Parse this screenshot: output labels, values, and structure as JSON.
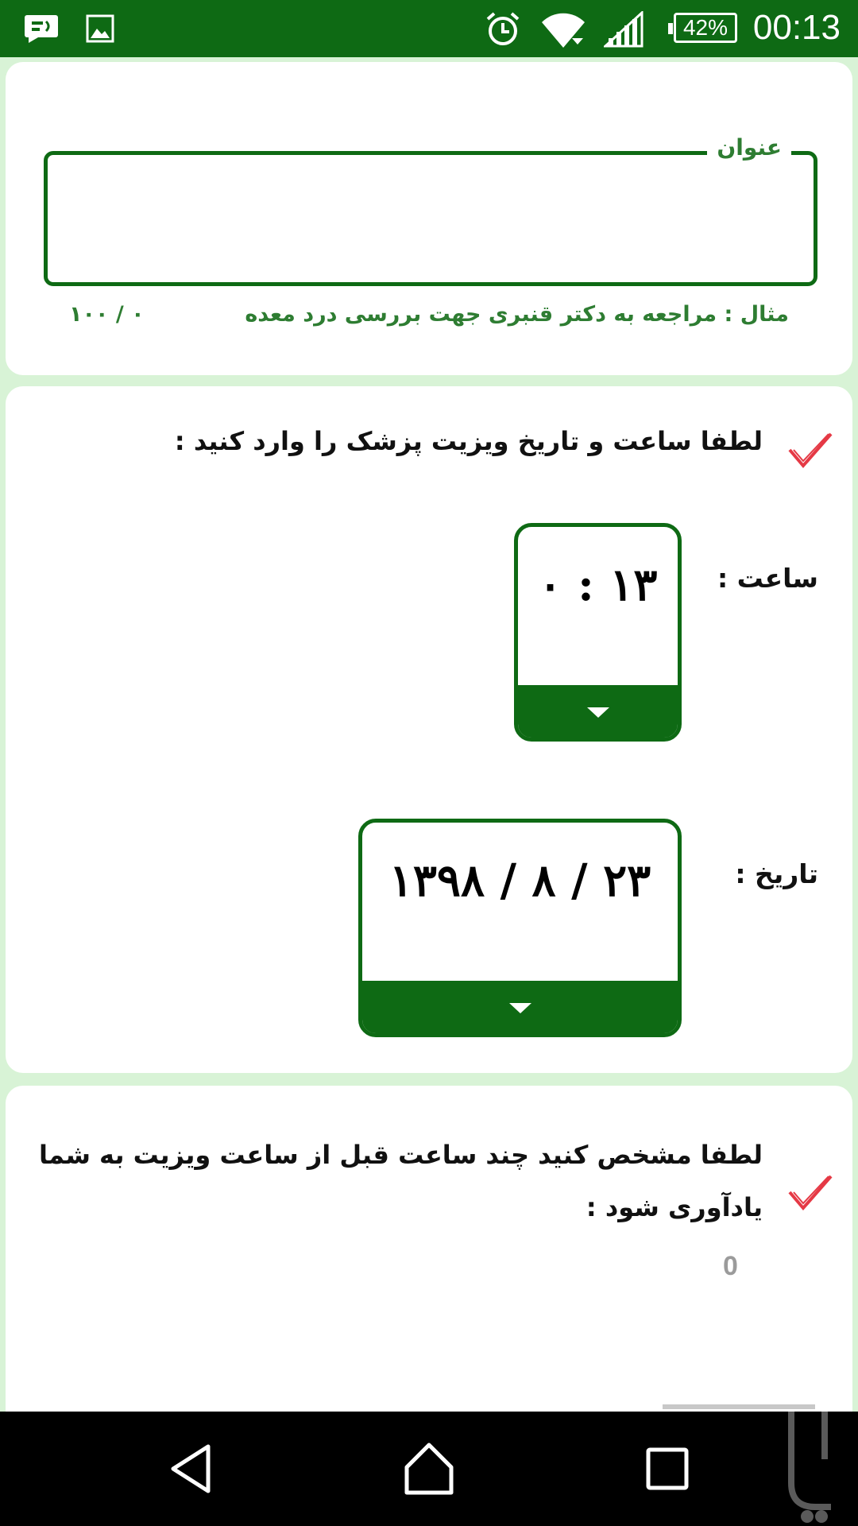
{
  "status_bar": {
    "battery": "42%",
    "time": "00:13"
  },
  "title_card": {
    "legend": "عنوان",
    "value": "",
    "helper": "مثال : مراجعه به دکتر قنبری جهت بررسی درد معده",
    "counter": "۰ / ۱۰۰"
  },
  "visit_card": {
    "prompt": "لطفا ساعت و تاریخ ویزیت پزشک را وارد کنید :",
    "time_label": "ساعت :",
    "time_value": "۱۳ : ۰",
    "date_label": "تاریخ :",
    "date_value": "۲۳ / ۸ / ۱۳۹۸"
  },
  "reminder_card": {
    "prompt_line1": "لطفا مشخص کنید چند ساعت قبل از ساعت ویزیت به شما",
    "prompt_line2": "یادآوری شود :",
    "hours_value": "0"
  },
  "colors": {
    "primary": "#0e6a14",
    "accent_text": "#2e7d32",
    "check": "#e53945",
    "background": "#d8f3d6"
  },
  "icons": [
    "message-icon",
    "image-icon",
    "alarm-icon",
    "wifi-icon",
    "signal-icon",
    "check-icon",
    "back-icon",
    "home-icon",
    "recents-icon",
    "bazaar-logo"
  ]
}
